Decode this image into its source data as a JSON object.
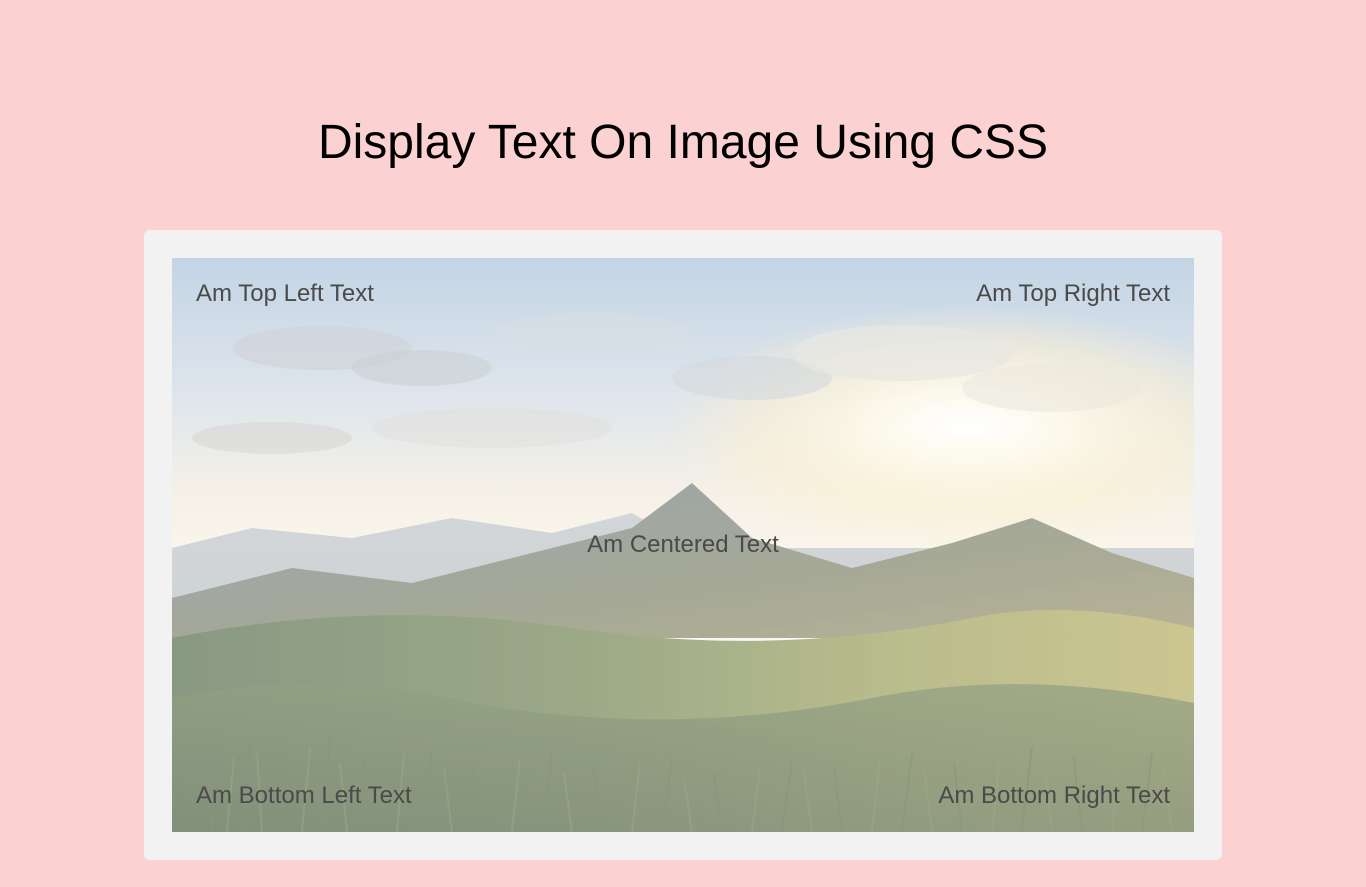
{
  "title": "Display Text On Image Using CSS",
  "overlays": {
    "topLeft": "Am Top Left Text",
    "topRight": "Am Top Right Text",
    "centered": "Am Centered Text",
    "bottomLeft": "Am Bottom Left Text",
    "bottomRight": "Am Bottom Right Text"
  }
}
